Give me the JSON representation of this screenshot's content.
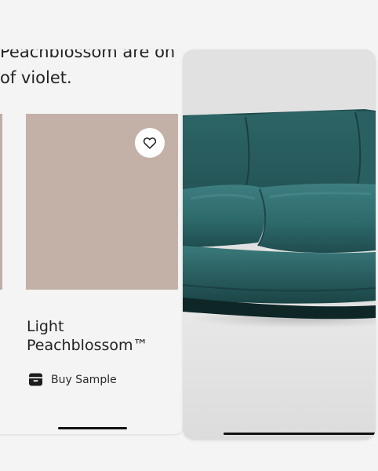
{
  "description": {
    "line1": "Peachblossom are on",
    "line2": "of violet."
  },
  "swatch": {
    "name_line1": "Light",
    "name_line2": "Peachblossom™",
    "color": "#c3b1a7",
    "previous_color": "#bfaea4",
    "favorite_icon": "heart-outline-icon"
  },
  "actions": {
    "buy_sample_label": "Buy Sample",
    "buy_sample_icon": "sample-box-icon"
  },
  "product_view": {
    "subject": "teal velvet sofa",
    "background_color": "#e2e2e2",
    "sofa_color": "#2f6a6c"
  }
}
